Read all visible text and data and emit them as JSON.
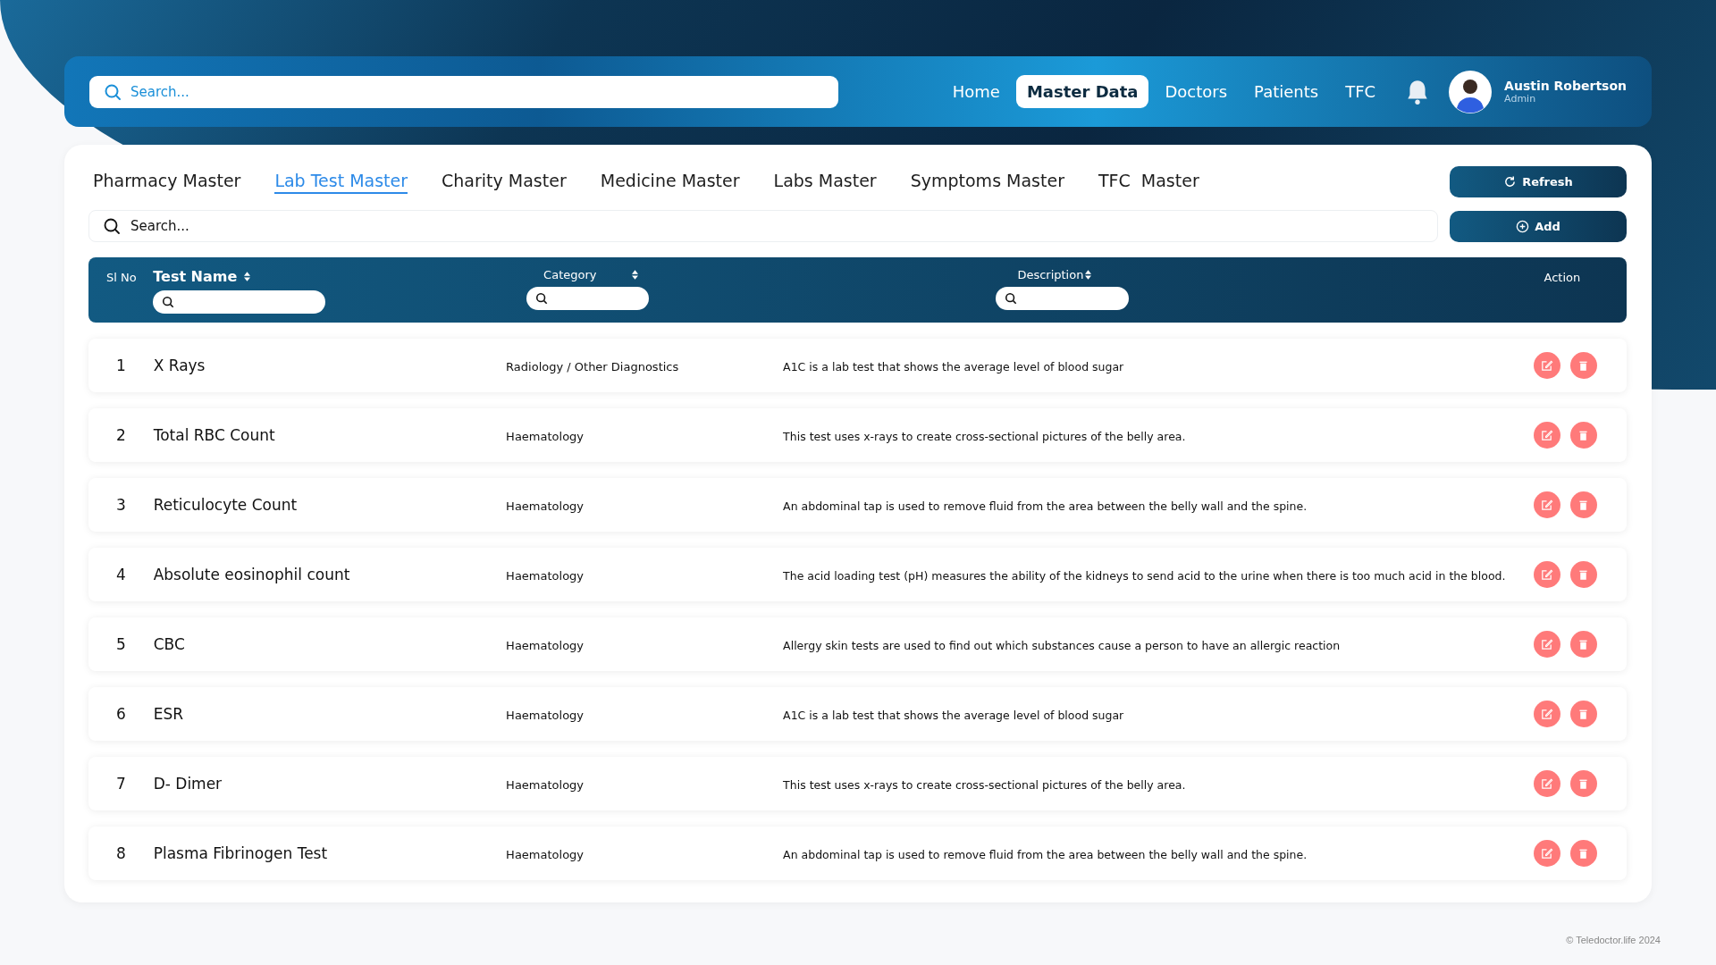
{
  "header": {
    "search": {
      "placeholder": "Search..."
    },
    "nav": [
      {
        "label": "Home",
        "selected": false
      },
      {
        "label": "Master Data",
        "selected": true
      },
      {
        "label": "Doctors",
        "selected": false
      },
      {
        "label": "Patients",
        "selected": false
      },
      {
        "label": "TFC",
        "selected": false
      }
    ],
    "user": {
      "name": "Austin Robertson",
      "role": "Admin"
    }
  },
  "tabs": [
    {
      "label": "Pharmacy Master",
      "selected": false
    },
    {
      "label": "Lab Test Master",
      "selected": true
    },
    {
      "label": "Charity Master",
      "selected": false
    },
    {
      "label": "Medicine Master",
      "selected": false
    },
    {
      "label": "Labs Master",
      "selected": false
    },
    {
      "label": "Symptoms Master",
      "selected": false
    },
    {
      "label": "TFC  Master",
      "selected": false
    }
  ],
  "buttons": {
    "refresh": "Refresh",
    "add": "Add"
  },
  "search": {
    "placeholder": "Search..."
  },
  "table": {
    "columns": [
      "Sl No",
      "Test Name",
      "Category",
      "Description",
      "Action"
    ],
    "rows": [
      {
        "no": "1",
        "name": "X Rays",
        "category": "Radiology / Other Diagnostics",
        "description": "A1C is a lab test that shows the average level of blood sugar"
      },
      {
        "no": "2",
        "name": "Total RBC Count",
        "category": "Haematology",
        "description": "This test uses x-rays to create cross-sectional pictures of the belly area."
      },
      {
        "no": "3",
        "name": "Reticulocyte Count",
        "category": "Haematology",
        "description": "An abdominal tap is used to remove fluid from the area between the belly wall and the spine."
      },
      {
        "no": "4",
        "name": "Absolute eosinophil count",
        "category": "Haematology",
        "description": "The acid loading test (pH) measures the ability of the kidneys to send acid to the urine when there is too much acid in the blood."
      },
      {
        "no": "5",
        "name": "CBC",
        "category": "Haematology",
        "description": "Allergy skin tests are used to find out which substances cause a person to have an allergic reaction"
      },
      {
        "no": "6",
        "name": "ESR",
        "category": "Haematology",
        "description": "A1C is a lab test that shows the average level of blood sugar"
      },
      {
        "no": "7",
        "name": "D- Dimer",
        "category": "Haematology",
        "description": "This test uses x-rays to create cross-sectional pictures of the belly area."
      },
      {
        "no": "8",
        "name": "Plasma Fibrinogen Test",
        "category": "Haematology",
        "description": "An abdominal tap is used to remove fluid from the area between the belly wall and the spine."
      }
    ]
  },
  "footer": "© Teledoctor.life 2024"
}
